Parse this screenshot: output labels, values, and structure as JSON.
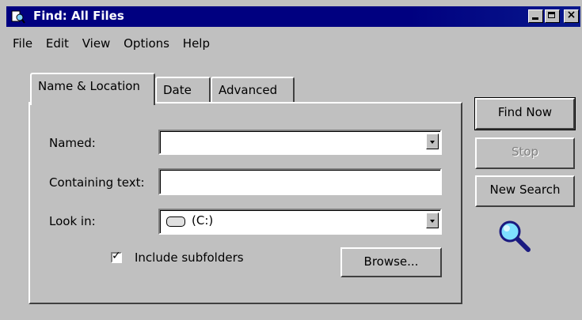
{
  "window": {
    "title": "Find: All Files"
  },
  "menu": [
    "File",
    "Edit",
    "View",
    "Options",
    "Help"
  ],
  "tabs": [
    "Name & Location",
    "Date",
    "Advanced"
  ],
  "form": {
    "named_label": "Named:",
    "named_value": "",
    "containing_label": "Containing text:",
    "containing_value": "",
    "lookin_label": "Look in:",
    "lookin_value": "(C:)",
    "include_subfolders_label": "Include subfolders",
    "include_subfolders_checked": true,
    "browse_label": "Browse..."
  },
  "buttons": {
    "find_now": "Find Now",
    "stop": "Stop",
    "new_search": "New Search"
  },
  "icons": {
    "title": "find-files-icon",
    "drive": "hard-drive-icon",
    "search": "magnifier-icon"
  }
}
